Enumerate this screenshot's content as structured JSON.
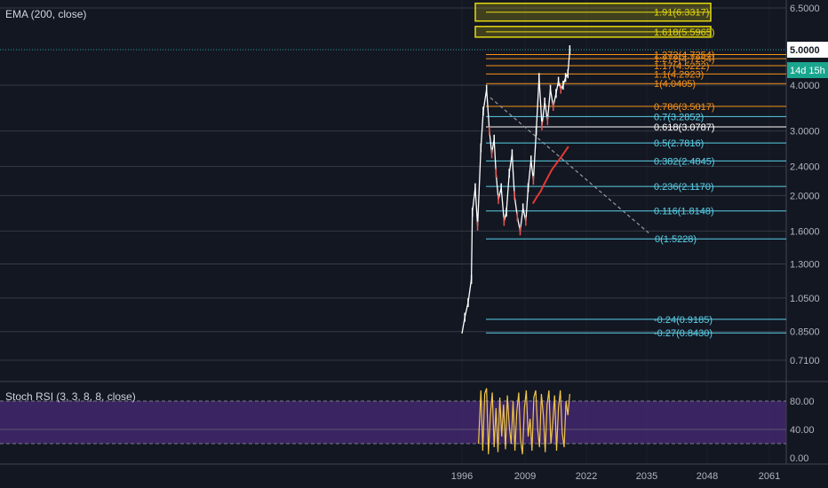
{
  "indicators": {
    "main": "EMA (200, close)",
    "lower": "Stoch RSI (3, 3, 8, 8, close)"
  },
  "price_axis": {
    "ticks": [
      "6.5000",
      "4.0000",
      "3.0000",
      "2.4000",
      "2.0000",
      "1.6000",
      "1.3000",
      "1.0500",
      "0.8500",
      "0.7100"
    ],
    "tick_values": [
      6.5,
      4.0,
      3.0,
      2.4,
      2.0,
      1.6,
      1.3,
      1.05,
      0.85,
      0.71
    ],
    "current_price": "5.0000",
    "countdown": "14d 15h"
  },
  "rsi_axis": {
    "ticks": [
      "80.00",
      "40.00",
      "0.00"
    ],
    "tick_values": [
      80,
      40,
      0
    ]
  },
  "time_axis": {
    "ticks": [
      "1996",
      "2009",
      "2022",
      "2035",
      "2048",
      "2061"
    ],
    "tick_values": [
      1996,
      2009,
      2022,
      2035,
      2048,
      2061
    ]
  },
  "colors": {
    "background": "#131722",
    "grid": "#363a45",
    "fib_low": "#5ad1e8",
    "fib_high": "#f7931a",
    "fib_ext": "#e4d810",
    "fib_mid": "#ffffff",
    "price_up": "#ffffff",
    "price_down": "#ef5350",
    "ema": "#e53935",
    "rsi_line": "#f0c64a",
    "rsi_band": "#4a2a78",
    "current_price_badge": "#1aa68e"
  },
  "chart_data": {
    "type": "line",
    "x_label_years": [
      1996,
      2009,
      2022,
      2035,
      2048,
      2061
    ],
    "y_scale": "log",
    "ylim": [
      0.65,
      7.0
    ],
    "series": [
      {
        "x": [
          1996.0,
          1996.6,
          1997.3,
          1998.0,
          1998.2,
          1998.8,
          1999.3,
          2000.0,
          2000.5,
          2001.2,
          2001.8,
          2002.3,
          2002.8,
          2003.2,
          2003.7,
          2004.3,
          2004.9,
          2005.4,
          2006.0,
          2006.6,
          2007.1,
          2007.7,
          2008.3,
          2008.9,
          2009.5,
          2010.0,
          2010.6,
          2011.1,
          2011.7,
          2012.3,
          2012.9,
          2013.5,
          2014.1,
          2014.7,
          2015.3,
          2015.9,
          2016.4,
          2016.9,
          2017.4,
          2017.9,
          2018.4,
          2018.8
        ],
        "y": [
          0.84,
          0.93,
          1.02,
          1.18,
          1.8,
          2.1,
          1.65,
          2.7,
          3.4,
          3.9,
          3.0,
          2.6,
          2.85,
          2.3,
          1.95,
          2.1,
          1.7,
          1.8,
          2.3,
          2.6,
          2.0,
          1.75,
          1.6,
          1.85,
          1.7,
          2.1,
          2.5,
          2.2,
          3.0,
          4.2,
          3.1,
          3.6,
          3.2,
          3.9,
          3.5,
          3.8,
          4.1,
          3.9,
          4.0,
          4.2,
          4.3,
          5.0
        ]
      },
      {
        "x": [
          2011.0,
          2011.8,
          2012.6,
          2013.4,
          2014.2,
          2015.0,
          2016.0,
          2017.0,
          2018.5
        ],
        "y": [
          1.9,
          1.98,
          2.05,
          2.15,
          2.25,
          2.35,
          2.45,
          2.55,
          2.72
        ]
      }
    ],
    "fib_levels": [
      {
        "label": "-0.27(0.8430)",
        "value": 0.843
      },
      {
        "label": "-0.24(0.9185)",
        "value": 0.9185
      },
      {
        "label": "0(1.5228)",
        "value": 1.5228
      },
      {
        "label": "0.116(1.8148)",
        "value": 1.8148
      },
      {
        "label": "0.236(2.1170)",
        "value": 2.117
      },
      {
        "label": "0.382(2.4845)",
        "value": 2.4845
      },
      {
        "label": "0.5(2.7816)",
        "value": 2.7816
      },
      {
        "label": "0.618(3.0787)",
        "value": 3.0787
      },
      {
        "label": "0.7(3.2852)",
        "value": 3.2852
      },
      {
        "label": "0.786(3.5017)",
        "value": 3.5017
      },
      {
        "label": "1(4.0405)",
        "value": 4.0405
      },
      {
        "label": "1.1(4.2923)",
        "value": 4.2923
      },
      {
        "label": "1.17(4.5222)",
        "value": 4.5222
      },
      {
        "label": "1.272(4.7254)",
        "value": 4.7254
      },
      {
        "label": "1.272(4.7254)",
        "value": 4.85
      },
      {
        "label": "1.618(5.5965)",
        "value": 5.5965
      },
      {
        "label": "1.91(6.3317)",
        "value": 6.3317
      }
    ],
    "diagonal_trendline": {
      "from": {
        "x": 2002.0,
        "y": 3.7
      },
      "to": {
        "x": 2035.5,
        "y": 1.58
      }
    },
    "current_price": 5.0,
    "stoch_rsi": {
      "ylim": [
        -5,
        100
      ],
      "overbought": 80,
      "oversold": 20,
      "midline": 40,
      "x": [
        1999.5,
        2000.0,
        2000.4,
        2000.8,
        2001.2,
        2001.6,
        2002.0,
        2002.4,
        2002.8,
        2003.2,
        2003.6,
        2004.0,
        2004.4,
        2004.8,
        2005.2,
        2005.6,
        2006.0,
        2006.4,
        2006.8,
        2007.2,
        2007.6,
        2008.0,
        2008.4,
        2008.8,
        2009.2,
        2009.6,
        2010.0,
        2010.4,
        2010.8,
        2011.2,
        2011.6,
        2012.0,
        2012.4,
        2012.8,
        2013.2,
        2013.6,
        2014.0,
        2014.4,
        2014.8,
        2015.2,
        2015.6,
        2016.0,
        2016.4,
        2016.8,
        2017.2,
        2017.6,
        2018.0,
        2018.4,
        2018.8
      ],
      "values": [
        20,
        95,
        10,
        90,
        98,
        5,
        60,
        92,
        15,
        70,
        8,
        85,
        30,
        75,
        12,
        88,
        45,
        20,
        80,
        10,
        65,
        92,
        25,
        5,
        70,
        95,
        30,
        55,
        10,
        85,
        95,
        40,
        15,
        90,
        60,
        8,
        75,
        95,
        20,
        50,
        88,
        10,
        70,
        95,
        35,
        15,
        80,
        60,
        90
      ]
    }
  }
}
